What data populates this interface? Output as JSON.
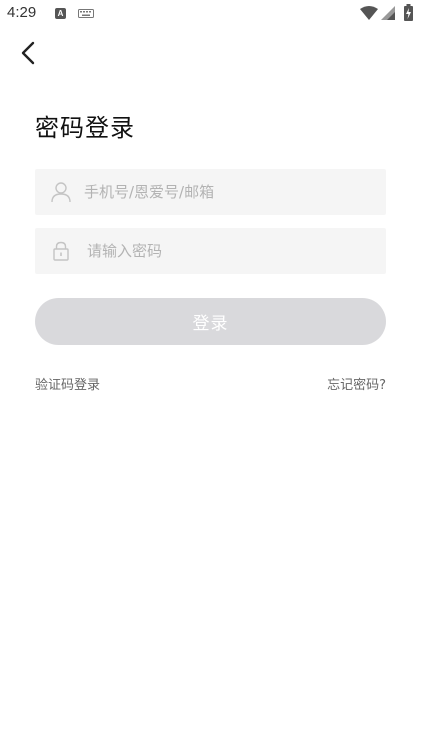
{
  "status_bar": {
    "time": "4:29",
    "notification_icon_letter": "A",
    "icons": [
      "a-notification-icon",
      "keyboard-icon",
      "wifi-icon",
      "cell-signal-icon",
      "battery-charging-icon"
    ]
  },
  "header": {
    "back_icon": "chevron-left-icon",
    "title": "密码登录"
  },
  "form": {
    "account": {
      "icon": "user-icon",
      "placeholder": "手机号/恩爱号/邮箱",
      "value": ""
    },
    "password": {
      "icon": "lock-icon",
      "placeholder": "请输入密码",
      "value": ""
    },
    "login_label": "登录"
  },
  "links": {
    "sms_login": "验证码登录",
    "forgot_password": "忘记密码?"
  },
  "colors": {
    "input_bg": "#f5f5f5",
    "button_disabled_bg": "#d9d9dc",
    "placeholder": "#b3b3b3",
    "link_text": "#666666"
  }
}
